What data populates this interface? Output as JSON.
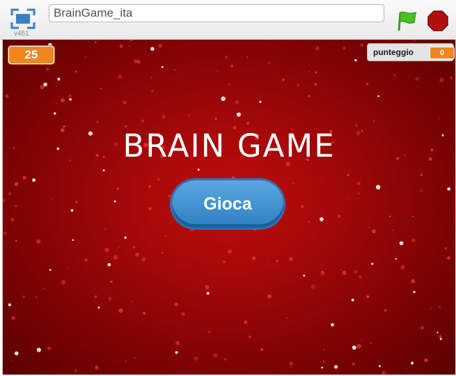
{
  "toolbar": {
    "fullscreen_icon": "fullscreen-icon",
    "version": "v461",
    "project_title": "BrainGame_ita",
    "flag_icon": "green-flag-icon",
    "stop_icon": "stop-icon",
    "colors": {
      "flag": "#4cbf22",
      "stop": "#b01010"
    }
  },
  "stage": {
    "timer_value": "25",
    "score": {
      "label": "punteggio",
      "value": "0"
    },
    "title": "BRAIN GAME",
    "play_label": "Gioca",
    "colors": {
      "background": "#a00808",
      "monitor": "#f0861e",
      "button": "#3b8fd4"
    }
  }
}
